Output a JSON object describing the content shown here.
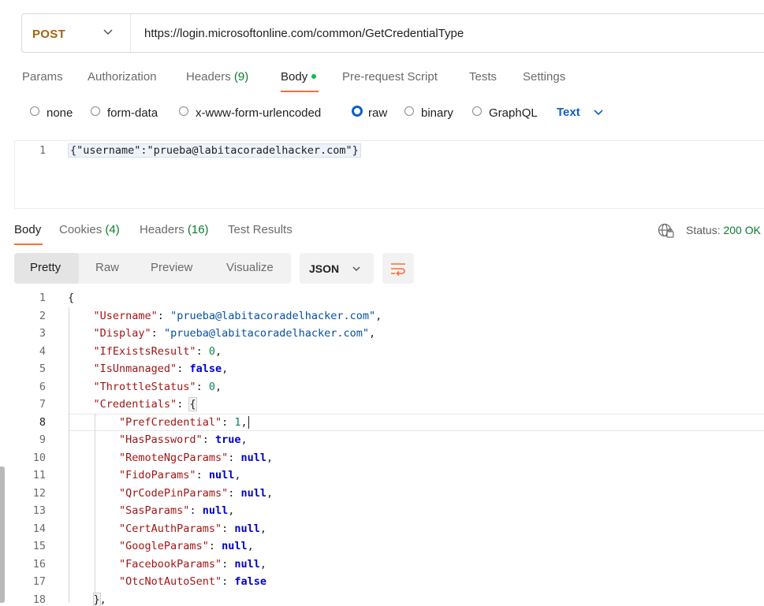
{
  "request": {
    "method": "POST",
    "url": "https://login.microsoftonline.com/common/GetCredentialType",
    "tabs": [
      {
        "label": "Params"
      },
      {
        "label": "Authorization"
      },
      {
        "label": "Headers",
        "count": "(9)"
      },
      {
        "label": "Body"
      },
      {
        "label": "Pre-request Script"
      },
      {
        "label": "Tests"
      },
      {
        "label": "Settings"
      }
    ],
    "body_types": [
      "none",
      "form-data",
      "x-www-form-urlencoded",
      "raw",
      "binary",
      "GraphQL"
    ],
    "selected_body_type": "raw",
    "raw_format": "Text",
    "editor": {
      "line_number": "1",
      "text": "{\"username\":\"prueba@labitacoradelhacker.com\"}"
    }
  },
  "response": {
    "tabs": [
      {
        "label": "Body"
      },
      {
        "label": "Cookies",
        "count": "(4)"
      },
      {
        "label": "Headers",
        "count": "(16)"
      },
      {
        "label": "Test Results"
      }
    ],
    "status_label": "Status:",
    "status_value": "200 OK",
    "views": [
      "Pretty",
      "Raw",
      "Preview",
      "Visualize"
    ],
    "active_view": "Pretty",
    "format": "JSON",
    "line_numbers": [
      "1",
      "2",
      "3",
      "4",
      "5",
      "6",
      "7",
      "8",
      "9",
      "10",
      "11",
      "12",
      "13",
      "14",
      "15",
      "16",
      "17",
      "18"
    ],
    "json": {
      "username_key": "\"Username\"",
      "username_val": "\"prueba@labitacoradelhacker.com\"",
      "display_key": "\"Display\"",
      "display_val": "\"prueba@labitacoradelhacker.com\"",
      "ifexists_key": "\"IfExistsResult\"",
      "ifexists_val": "0",
      "isunmanaged_key": "\"IsUnmanaged\"",
      "isunmanaged_val": "false",
      "throttle_key": "\"ThrottleStatus\"",
      "throttle_val": "0",
      "credentials_key": "\"Credentials\"",
      "prefcred_key": "\"PrefCredential\"",
      "prefcred_val": "1",
      "haspassword_key": "\"HasPassword\"",
      "haspassword_val": "true",
      "remotengc_key": "\"RemoteNgcParams\"",
      "fido_key": "\"FidoParams\"",
      "qrcode_key": "\"QrCodePinParams\"",
      "sas_key": "\"SasParams\"",
      "certauth_key": "\"CertAuthParams\"",
      "google_key": "\"GoogleParams\"",
      "facebook_key": "\"FacebookParams\"",
      "otc_key": "\"OtcNotAutoSent\"",
      "otc_val": "false",
      "null_val": "null"
    }
  },
  "icons": {
    "method_chevron": "chevron-down-icon",
    "format_chevron": "chevron-down-icon",
    "globe": "globe-lock-icon",
    "wrap": "text-wrap-icon"
  },
  "colors": {
    "accent": "#ff6c37",
    "method": "#a6630c",
    "link_blue": "#0f5fc7",
    "status_green": "#0a7d2c"
  }
}
